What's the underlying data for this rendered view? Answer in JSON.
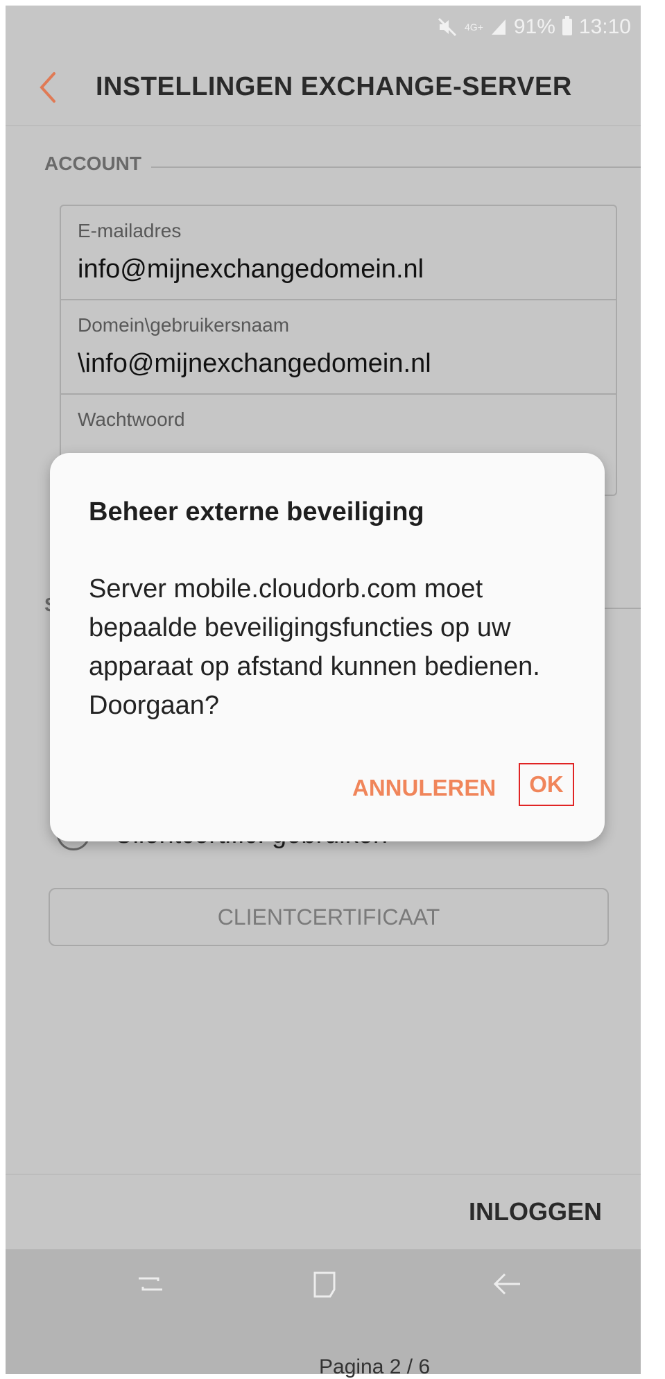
{
  "status_bar": {
    "network": "4G+",
    "battery": "91%",
    "time": "13:10"
  },
  "header": {
    "title": "INSTELLINGEN EXCHANGE-SERVER"
  },
  "account_section": {
    "heading": "ACCOUNT",
    "fields": [
      {
        "label": "E-mailadres",
        "value": "info@mijnexchangedomein.nl"
      },
      {
        "label": "Domein\\gebruikersnaam",
        "value": "\\info@mijnexchangedomein.nl"
      },
      {
        "label": "Wachtwoord",
        "value": "••••••••"
      }
    ]
  },
  "server_section": {
    "heading": "S"
  },
  "client_cert": {
    "checkbox_label": "Clientcertific. gebruiken",
    "button_label": "CLIENTCERTIFICAAT"
  },
  "footer": {
    "login_label": "INLOGGEN",
    "caption": "Pagina 2 / 6"
  },
  "dialog": {
    "title": "Beheer externe beveiliging",
    "message": "Server mobile.cloudorb.com moet bepaalde beveiligingsfuncties op uw apparaat op afstand kunnen bedienen. Doorgaan?",
    "cancel_label": "ANNULEREN",
    "ok_label": "OK"
  },
  "colors": {
    "accent": "#f0855a",
    "highlight_border": "#e02424",
    "scrim_background": "#c6c6c6",
    "dialog_background": "#fafafa"
  },
  "icons": {
    "back": "chevron-left-icon",
    "mute": "mute-icon",
    "signal": "signal-icon",
    "battery": "battery-icon",
    "nav_recent": "recent-apps-icon",
    "nav_home": "home-icon",
    "nav_back": "back-arrow-icon"
  }
}
